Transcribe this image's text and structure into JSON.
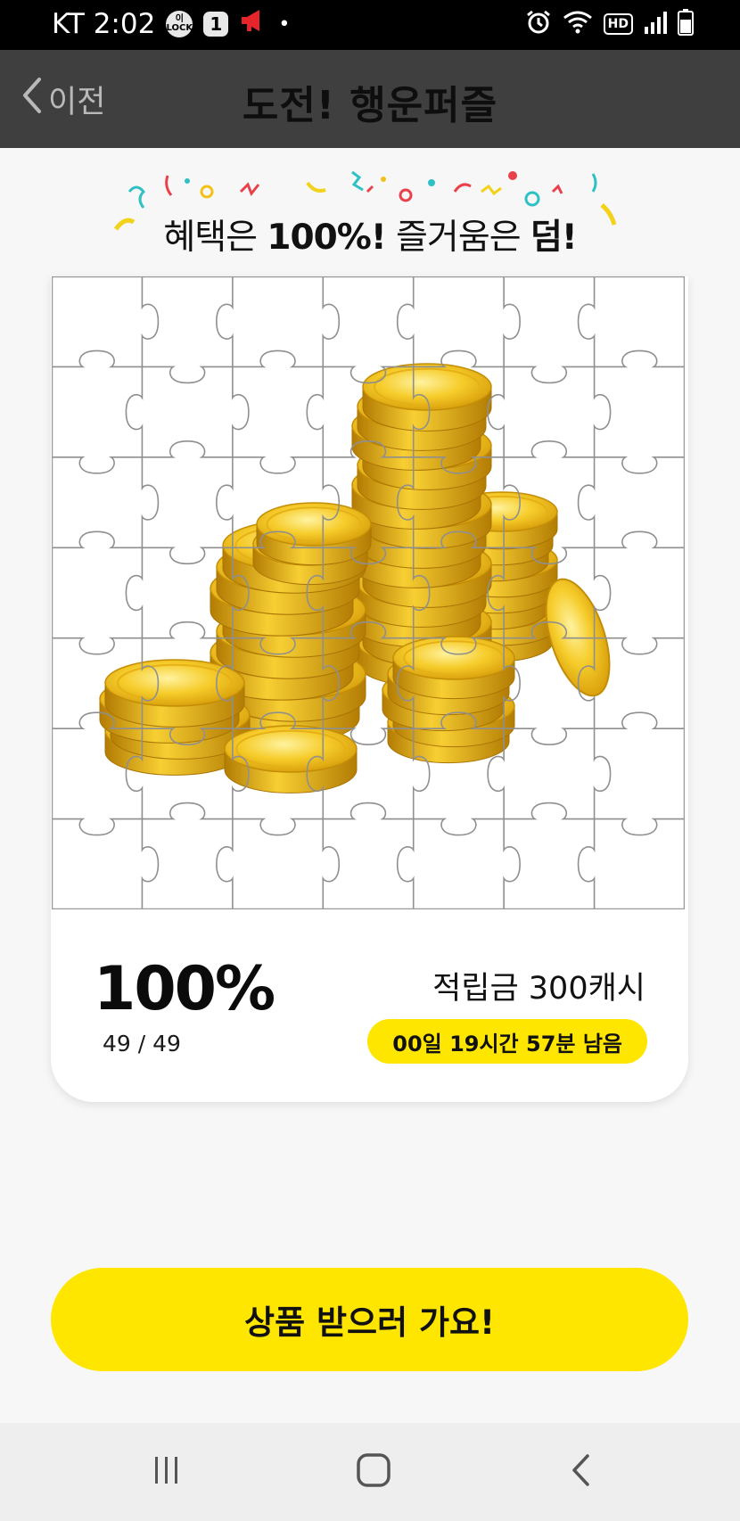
{
  "status_bar": {
    "carrier_time": "KT 2:02",
    "lock_badge": "이 LOCK",
    "notification_count": "1",
    "dot": "•",
    "hd_label": "HD"
  },
  "header": {
    "back_label": "이전",
    "title": "도전! 행운퍼즐"
  },
  "headline": {
    "part1": "혜택은 ",
    "bold1": "100%!",
    "part2": " 즐거움은 ",
    "bold2": "덤!"
  },
  "puzzle": {
    "rows": 7,
    "cols": 7,
    "image": "gold-coins-image"
  },
  "progress": {
    "percent_label": "100%",
    "pieces_count": "49 / 49",
    "pieces_collected": 49,
    "pieces_total": 49
  },
  "reward": {
    "label": "적립금 300캐시",
    "time_left": "00일 19시간 57분 남음"
  },
  "cta": {
    "label": "상품 받으러 가요!"
  },
  "colors": {
    "accent_yellow": "#ffe600",
    "header_bg": "#3f3f3f",
    "coin_gold": "#f2c21a"
  },
  "nav_bar": {
    "recents": "recents-icon",
    "home": "home-icon",
    "back": "back-icon"
  }
}
